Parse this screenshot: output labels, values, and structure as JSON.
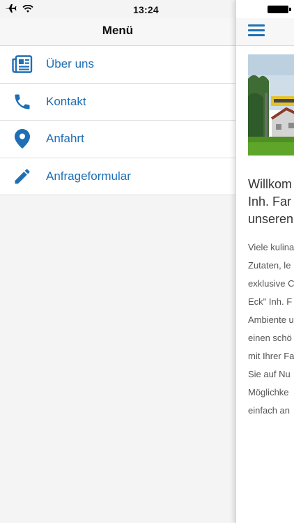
{
  "status_bar": {
    "time": "13:24"
  },
  "drawer": {
    "title": "Menü",
    "items": [
      {
        "label": "Über uns",
        "icon": "newspaper-icon"
      },
      {
        "label": "Kontakt",
        "icon": "phone-icon"
      },
      {
        "label": "Anfahrt",
        "icon": "location-pin-icon"
      },
      {
        "label": "Anfrageformular",
        "icon": "pencil-icon"
      }
    ]
  },
  "content": {
    "headline_lines": [
      "Willkom",
      "Inh. Far",
      "unseren"
    ],
    "body_lines": [
      "Viele kulina",
      "Zutaten, le",
      "exklusive C",
      "Eck\" Inh. F",
      "Ambiente u",
      "einen schö",
      "mit Ihrer Fa",
      "Sie auf Nu",
      "Möglichke",
      "einfach an"
    ]
  },
  "colors": {
    "accent": "#1e6fb5",
    "drawer_bg": "#f4f4f5"
  }
}
